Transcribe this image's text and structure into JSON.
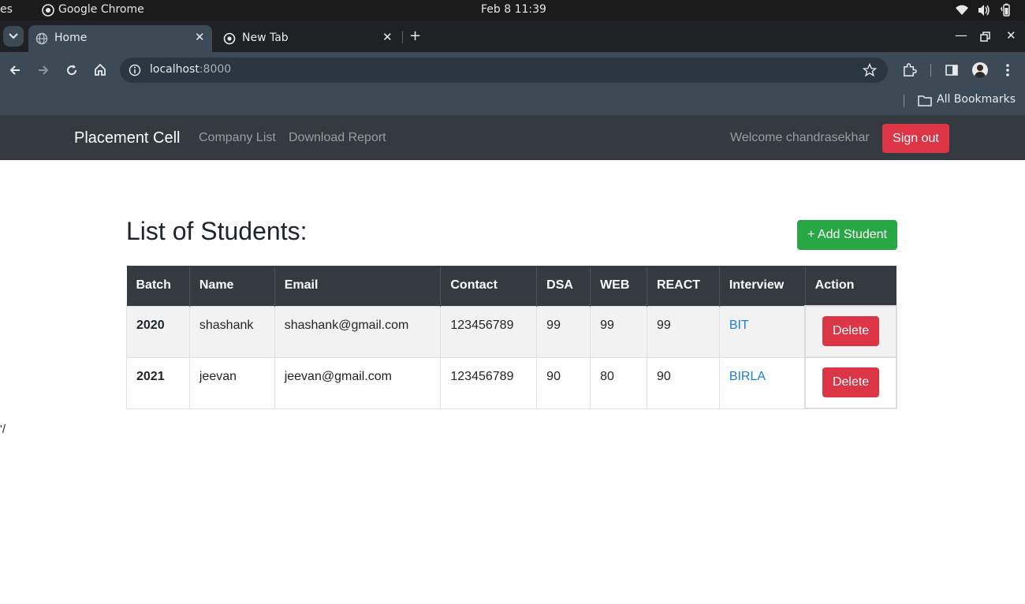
{
  "os": {
    "activities_fragment": "es",
    "app_name": "Google Chrome",
    "clock": "Feb 8  11:39"
  },
  "browser": {
    "tabs": [
      {
        "title": "Home",
        "active": true
      },
      {
        "title": "New Tab",
        "active": false
      }
    ],
    "url_host": "localhost",
    "url_port": ":8000",
    "bookmarks_label": "All Bookmarks"
  },
  "navbar": {
    "brand": "Placement Cell",
    "links": [
      "Company List",
      "Download Report"
    ],
    "welcome": "Welcome chandrasekhar",
    "signout": "Sign out"
  },
  "page": {
    "heading": "List of Students:",
    "add_button": "+ Add Student",
    "stray_text": "'/"
  },
  "table": {
    "headers": [
      "Batch",
      "Name",
      "Email",
      "Contact",
      "DSA",
      "WEB",
      "REACT",
      "Interview",
      "Action"
    ],
    "rows": [
      {
        "batch": "2020",
        "name": "shashank",
        "email": "shashank@gmail.com",
        "contact": "123456789",
        "dsa": "99",
        "web": "99",
        "react": "99",
        "interview": "BIT",
        "action": "Delete"
      },
      {
        "batch": "2021",
        "name": "jeevan",
        "email": "jeevan@gmail.com",
        "contact": "123456789",
        "dsa": "90",
        "web": "80",
        "react": "90",
        "interview": "BIRLA",
        "action": "Delete"
      }
    ]
  },
  "colors": {
    "navbar_bg": "#343a40",
    "danger": "#dc3545",
    "success": "#28a745",
    "link": "#1a7fe0"
  }
}
